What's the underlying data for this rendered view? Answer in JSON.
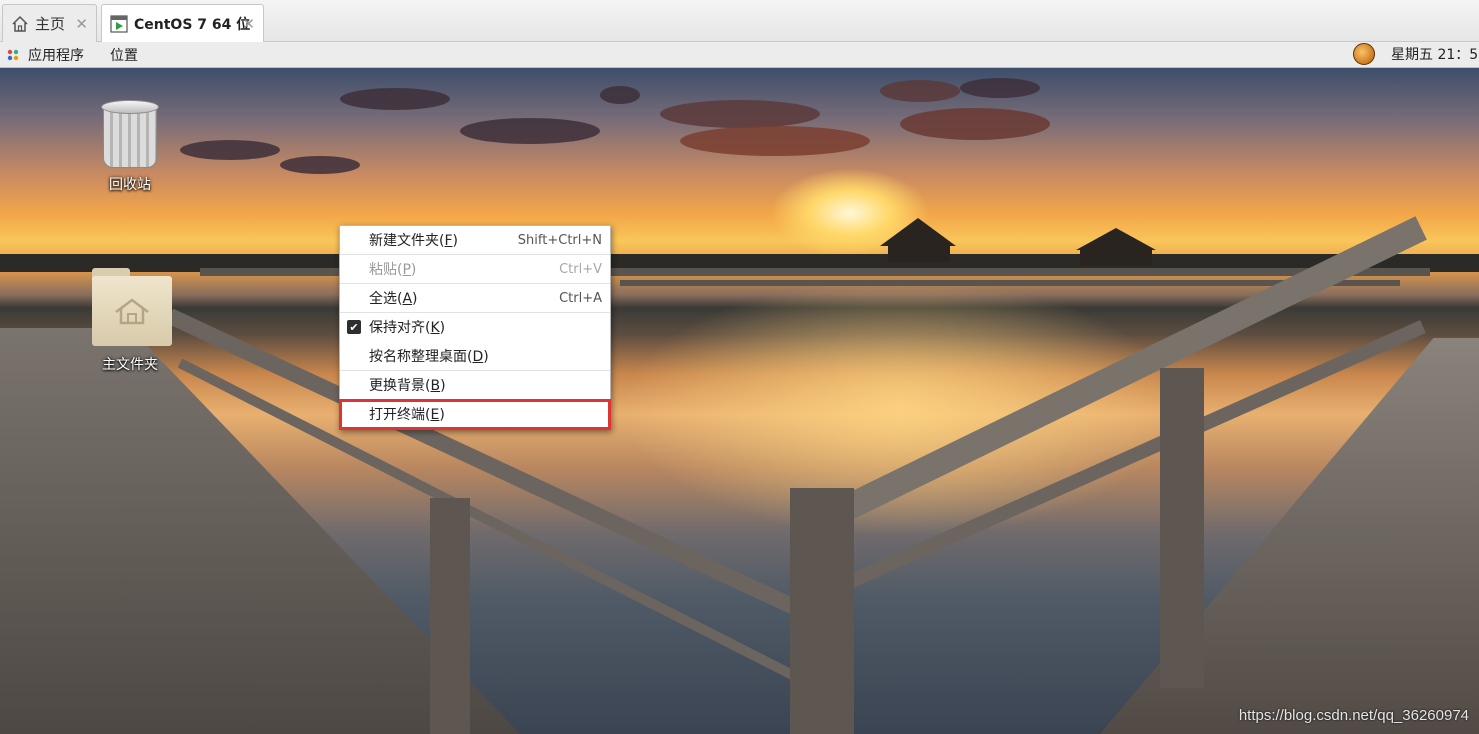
{
  "tabs": [
    {
      "label": "主页",
      "icon": "home-icon"
    },
    {
      "label": "CentOS 7 64 位",
      "icon": "vm-run-icon"
    }
  ],
  "panel": {
    "apps_label": "应用程序",
    "places_label": "位置",
    "clock": "星期五 21：5"
  },
  "desktop_icons": [
    {
      "label": "回收站",
      "icon": "trash-icon"
    },
    {
      "label": "主文件夹",
      "icon": "home-folder-icon"
    }
  ],
  "context_menu": {
    "items": [
      {
        "label": "新建文件夹(",
        "mnemonic": "F",
        "suffix": ")",
        "shortcut": "Shift+Ctrl+N",
        "enabled": true
      },
      {
        "label": "粘贴(",
        "mnemonic": "P",
        "suffix": ")",
        "shortcut": "Ctrl+V",
        "enabled": false
      },
      {
        "label": "全选(",
        "mnemonic": "A",
        "suffix": ")",
        "shortcut": "Ctrl+A",
        "enabled": true
      },
      {
        "label": "保持对齐(",
        "mnemonic": "K",
        "suffix": ")",
        "shortcut": "",
        "enabled": true,
        "checked": true
      },
      {
        "label": "按名称整理桌面(",
        "mnemonic": "D",
        "suffix": ")",
        "shortcut": "",
        "enabled": true
      },
      {
        "label": "更换背景(",
        "mnemonic": "B",
        "suffix": ")",
        "shortcut": "",
        "enabled": true
      },
      {
        "label": "打开终端(",
        "mnemonic": "E",
        "suffix": ")",
        "shortcut": "",
        "enabled": true,
        "highlighted": true
      }
    ],
    "highlight_color": "#e03434"
  },
  "watermark": "https://blog.csdn.net/qq_36260974"
}
